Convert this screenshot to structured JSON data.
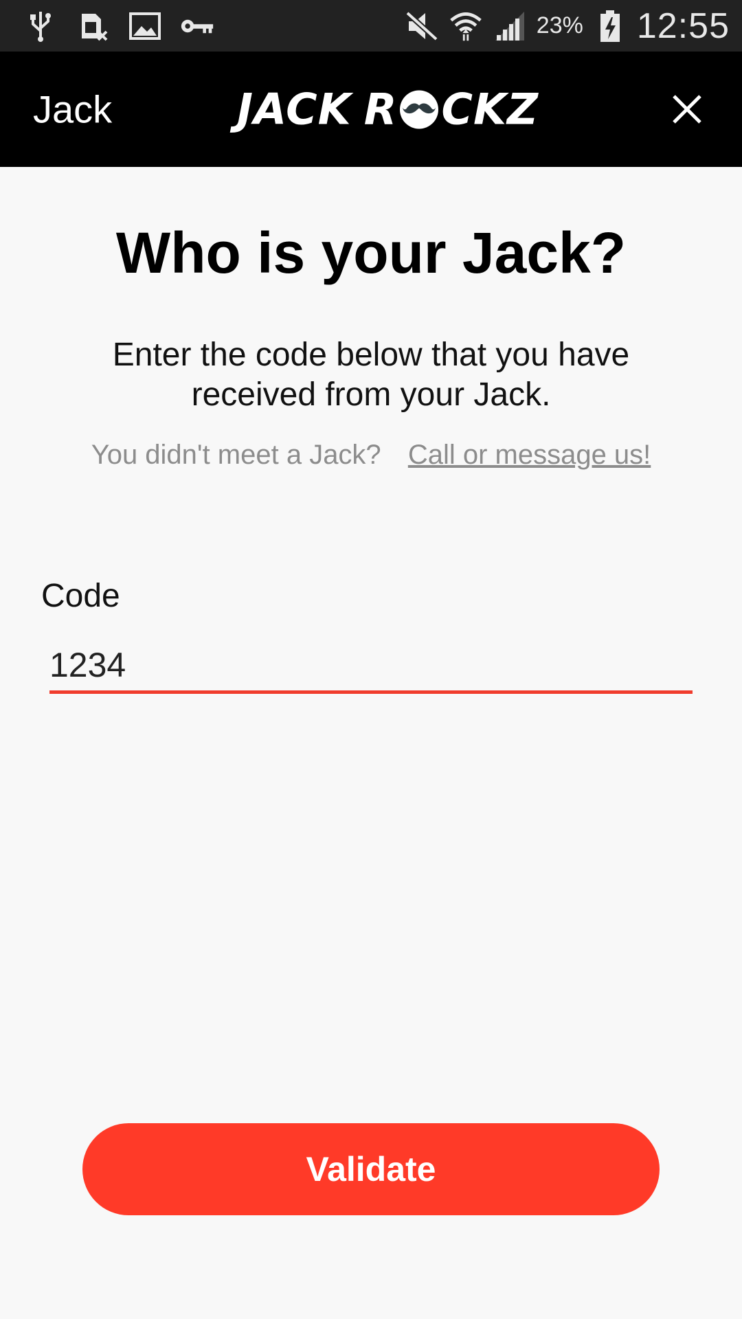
{
  "status_bar": {
    "battery_percent": "23%",
    "time": "12:55",
    "icons": [
      "usb-icon",
      "sim-card-x-icon",
      "image-icon",
      "key-icon",
      "mute-icon",
      "wifi-icon",
      "signal-icon",
      "battery-charging-icon"
    ]
  },
  "app_bar": {
    "title": "Jack",
    "logo_text_left": "JACK",
    "logo_text_right_a": "R",
    "logo_text_right_b": "CKZ",
    "close_icon": "close-icon"
  },
  "main": {
    "heading": "Who is your Jack?",
    "description": "Enter the code below that you have received from your Jack.",
    "contact_question": "You didn't meet a Jack?",
    "contact_link": "Call or message us!",
    "code_label": "Code",
    "code_value": "1234",
    "validate_label": "Validate"
  },
  "colors": {
    "accent": "#ff3a28",
    "app_bar_bg": "#000000",
    "status_bar_bg": "#222222",
    "page_bg": "#f8f8f8"
  }
}
